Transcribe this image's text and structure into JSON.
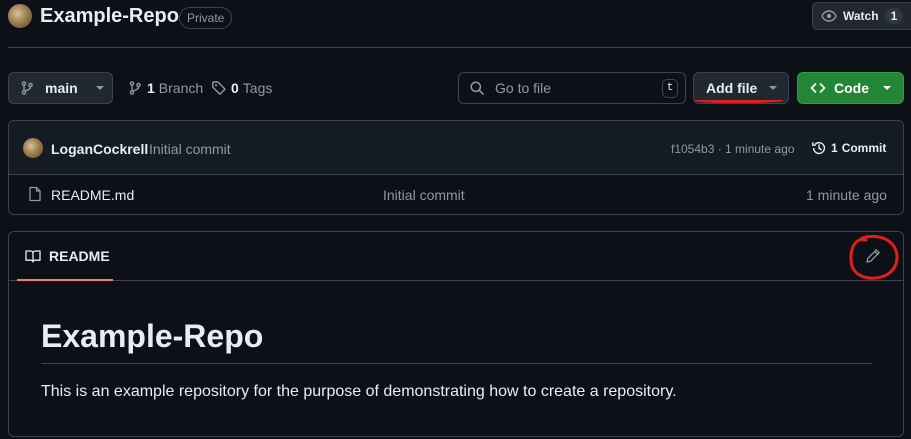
{
  "header": {
    "repo_name": "Example-Repo",
    "visibility_badge": "Private",
    "watch_label": "Watch",
    "watch_count": "1"
  },
  "toolbar": {
    "branch_name": "main",
    "branch_count": "1",
    "branch_label": "Branch",
    "tag_count": "0",
    "tag_label": "Tags",
    "goto_placeholder": "Go to file",
    "goto_shortcut": "t",
    "add_file_label": "Add file",
    "code_label": "Code"
  },
  "latest_commit": {
    "author": "LoganCockrell",
    "message": "Initial commit",
    "hash_time": "f1054b3 · 1 minute ago",
    "commit_count": "1",
    "commit_label": "Commit"
  },
  "files": [
    {
      "name": "README.md",
      "message": "Initial commit",
      "time": "1 minute ago"
    }
  ],
  "readme": {
    "tab_label": "README",
    "heading": "Example-Repo",
    "body": "This is an example repository for the purpose of demonstrating how to create a repository."
  },
  "colors": {
    "background": "#0d1117",
    "border": "#3d444d",
    "code_button": "#238636",
    "tab_underline": "#f78166",
    "annotation_red": "#e01e1e"
  }
}
